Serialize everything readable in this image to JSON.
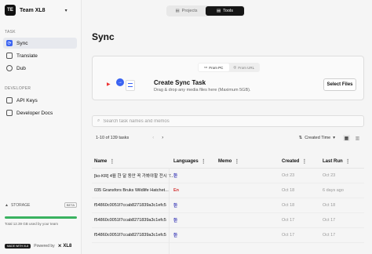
{
  "sidebar": {
    "team_logo": "TE",
    "team_name": "Team XL8",
    "section_task": "TASK",
    "task_items": [
      {
        "label": "Sync",
        "icon": "sync-icon"
      },
      {
        "label": "Translate",
        "icon": "translate-icon"
      },
      {
        "label": "Dub",
        "icon": "dub-icon"
      }
    ],
    "section_developer": "DEVELOPER",
    "developer_items": [
      {
        "label": "API Keys",
        "icon": "key-icon"
      },
      {
        "label": "Developer Docs",
        "icon": "docs-icon"
      }
    ],
    "storage_label": "STORAGE",
    "storage_badge": "BETA",
    "storage_used_fraction": 1.0,
    "storage_text": "Total 12.39 GB used by your team",
    "made_badge": "MADE WITH XL8",
    "powered_by": "Powered by",
    "brand": "XL8"
  },
  "mode_switch": {
    "projects": "Projects",
    "tools": "Tools",
    "active": "tools"
  },
  "main": {
    "title": "Sync",
    "card": {
      "source_tabs": [
        "From PC",
        "From URL"
      ],
      "title": "Create Sync Task",
      "subtitle": "Drag & drop any media files here (Maximum 5GB).",
      "select_button": "Select Files"
    },
    "search_placeholder": "Search task names and memos",
    "count_text": "1-10 of 139 tasks",
    "sort_label": "Created Time",
    "columns": [
      "Name",
      "Languages",
      "Memo",
      "Created",
      "Last Run"
    ],
    "rows": [
      {
        "name": "[ko-KR] 4월 한 달 동안 꼭 가봐야할 전시 T...",
        "lang": "한",
        "lang_type": "ko",
        "memo": "",
        "created": "Oct 23",
        "last_run": "Oct 23"
      },
      {
        "name": "035 Gransfors Bruks Wildlife Hatchet...",
        "lang": "En",
        "lang_type": "en",
        "memo": "",
        "created": "Oct 18",
        "last_run": "6 days ago"
      },
      {
        "name": "f54860c0051f7ccab8271839a3c1efc5",
        "lang": "한",
        "lang_type": "ko",
        "memo": "",
        "created": "Oct 18",
        "last_run": "Oct 18"
      },
      {
        "name": "f54860c0051f7ccab8271839a3c1efc5",
        "lang": "한",
        "lang_type": "ko",
        "memo": "",
        "created": "Oct 17",
        "last_run": "Oct 17"
      },
      {
        "name": "f54860c0051f7ccab8271839a3c1efc5",
        "lang": "한",
        "lang_type": "ko",
        "memo": "",
        "created": "Oct 17",
        "last_run": "Oct 17"
      }
    ]
  }
}
